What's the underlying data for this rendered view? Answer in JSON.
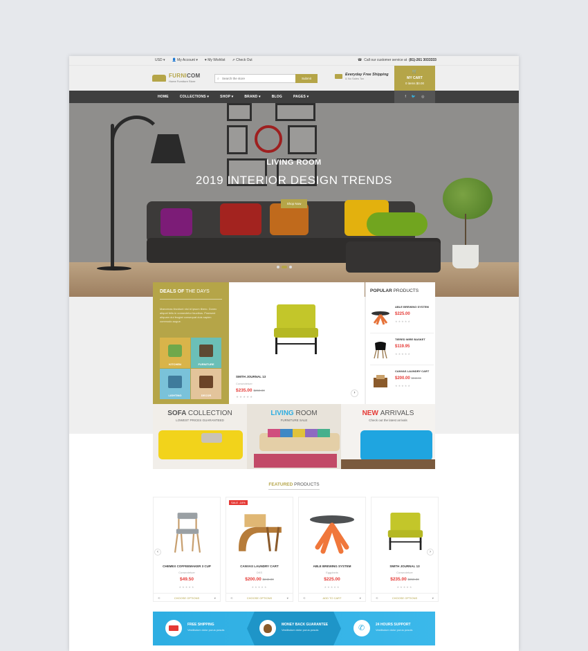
{
  "topbar": {
    "currency": "USD ▾",
    "account": "My Account ▾",
    "wishlist": "My Wishlist",
    "checkout": "Check Out",
    "call_text": "Call our customer service at",
    "phone": "(81)-261 3033333"
  },
  "header": {
    "logo_name_a": "FURNI",
    "logo_name_b": "COM",
    "logo_tagline": "Home Furniture Store",
    "search_placeholder": "Search the store",
    "search_button": "Submit",
    "shipping_title": "Everyday Free Shipping",
    "shipping_sub": "& No Sales Tax",
    "cart_label": "MY CART",
    "cart_sub": "0 items $0.00"
  },
  "nav": {
    "items": [
      "HOME",
      "COLLECTIONS ▾",
      "SHOP ▾",
      "BRAND ▾",
      "BLOG",
      "PAGES ▾"
    ]
  },
  "hero": {
    "subtitle": "LIVING ROOM",
    "title": "2019 INTERIOR DESIGN TRENDS",
    "button": "Shop Now"
  },
  "deals": {
    "title_a": "DEALS OF",
    "title_b": "THE DAYS",
    "text": "Maecenas tincidunt nisi id ipsum libero. Donec aliquet felis in consectetur faucibus. Praesent aliquam dui feugiat consequat duis sapien commodo augue.",
    "tiles": [
      "KITCHEN",
      "FURNITURE",
      "LIGHTING",
      "DECOR"
    ],
    "main_name": "SMITH JOURNAL 13",
    "main_cat": "Consectetuer",
    "main_price": "$235.00",
    "main_old": "$250.00"
  },
  "popular": {
    "title_a": "POPULAR",
    "title_b": "PRODUCTS",
    "items": [
      {
        "name": "ABLE BREWING SYSTEM",
        "price": "$225.00",
        "old": ""
      },
      {
        "name": "TIERED WIRE BASKET",
        "price": "$119.95",
        "old": ""
      },
      {
        "name": "CANVAS LAUNDRY CART",
        "price": "$200.00",
        "old": "$240.00"
      }
    ]
  },
  "banners": [
    {
      "title_a": "SOFA",
      "title_b": "COLLECTION",
      "sub": "LOWEST PRICES GUARANTEED"
    },
    {
      "title_a": "LIVING",
      "title_b": "ROOM",
      "sub": "FURNITURE SALE"
    },
    {
      "title_a": "NEW",
      "title_b": "ARRIVALS",
      "sub": "Check out the latest arrivals"
    }
  ],
  "featured": {
    "title_a": "FEATURED",
    "title_b": "PRODUCTS",
    "products": [
      {
        "name": "CHEMEX COFFEEMAKER 3 CUP",
        "cat": "Consectetuer",
        "price": "$49.50",
        "old": "",
        "action": "CHOOSE OPTIONS",
        "badge": ""
      },
      {
        "name": "CANVAS LAUNDRY CART",
        "cat": "DKS",
        "price": "$200.00",
        "old": "$240.00",
        "action": "CHOOSE OPTIONS",
        "badge": "SALE -16%"
      },
      {
        "name": "ABLE BREWING SYSTEM",
        "cat": "Eggplants",
        "price": "$225.00",
        "old": "",
        "action": "ADD TO CART",
        "badge": ""
      },
      {
        "name": "SMITH JOURNAL 13",
        "cat": "Consectetuer",
        "price": "$235.00",
        "old": "$250.00",
        "action": "CHOOSE OPTIONS",
        "badge": ""
      }
    ]
  },
  "services": [
    {
      "title": "FREE SHIPPING",
      "desc": "Vestibulum dolor purus posuis"
    },
    {
      "title": "MONEY BACK GUARANTEE",
      "desc": "Vestibulum dolor purus posuis"
    },
    {
      "title": "24 HOURS SUPPORT",
      "desc": "Vestibulum dolor purus posuis"
    }
  ],
  "colors": {
    "accent": "#b5a548",
    "price": "#e53935",
    "nav": "#3f3f3f",
    "services": "#2eaee2"
  }
}
